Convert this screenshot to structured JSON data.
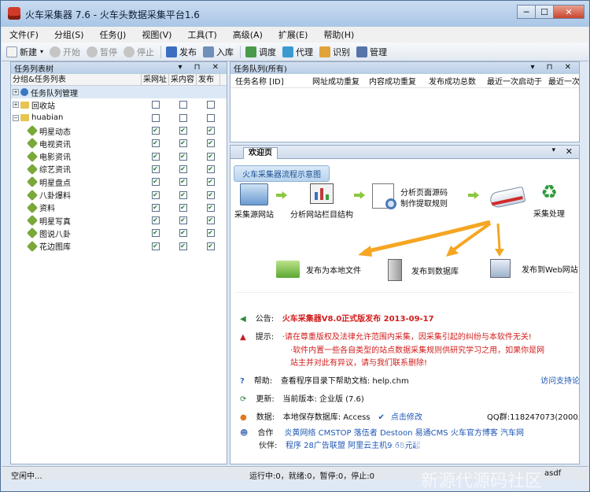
{
  "window": {
    "title": "火车采集器 7.6 - 火车头数据采集平台1.6",
    "min": "─",
    "max": "☐",
    "close": "✕"
  },
  "menu": [
    "文件(F)",
    "分组(S)",
    "任务(J)",
    "视图(V)",
    "工具(T)",
    "高级(A)",
    "扩展(E)",
    "帮助(H)"
  ],
  "toolbar": {
    "new": "新建",
    "start": "开始",
    "pause": "暂停",
    "stop": "停止",
    "publish": "发布",
    "import": "入库",
    "schedule": "调度",
    "proxy": "代理",
    "recognize": "识别",
    "manage": "管理"
  },
  "left": {
    "title": "任务列表树",
    "ctl": "▾ ⊓ ✕",
    "col_group": "分组&任务列表",
    "col_url": "采网址",
    "col_content": "采内容",
    "col_pub": "发布",
    "items": [
      {
        "name": "任务队列管理",
        "type": "queue"
      },
      {
        "name": "回收站",
        "type": "folder"
      },
      {
        "name": "huabian",
        "type": "folder-open"
      },
      {
        "name": "明星动态",
        "type": "task"
      },
      {
        "name": "电视资讯",
        "type": "task"
      },
      {
        "name": "电影资讯",
        "type": "task"
      },
      {
        "name": "综艺资讯",
        "type": "task"
      },
      {
        "name": "明星盘点",
        "type": "task"
      },
      {
        "name": "八卦爆料",
        "type": "task"
      },
      {
        "name": "资料",
        "type": "task"
      },
      {
        "name": "明星写真",
        "type": "task"
      },
      {
        "name": "图说八卦",
        "type": "task"
      },
      {
        "name": "花边图库",
        "type": "task"
      }
    ]
  },
  "queue": {
    "title": "任务队列(所有)",
    "ctl": "▾ ⊓ ✕",
    "cols": [
      "任务名称 [ID]",
      "网址成功重复",
      "内容成功重复",
      "发布成功总数",
      "最近一次启动于",
      "最近一次"
    ]
  },
  "welcome": {
    "tab": "欢迎页",
    "close": "✕",
    "arrow": "▾",
    "flow_title": "火车采集器流程示意图",
    "steps": [
      "采集源网站",
      "分析网站栏目结构",
      "分析页面源码\n制作提取规则",
      "采集处理"
    ],
    "outputs": [
      "发布为本地文件",
      "发布到数据库",
      "发布到Web网站"
    ],
    "rows": [
      {
        "label": "公告:",
        "text": "火车采集器V8.0正式版发布  2013-09-17"
      },
      {
        "label": "提示:",
        "text": "·请在尊重版权及法律允许范围内采集，因采集引起的纠纷与本软件无关!"
      },
      {
        "label": "",
        "text": "·软件内置一些各自类型的站点数据采集规则供研究学习之用，如果你是网"
      },
      {
        "label": "",
        "text": "站主并对此有异议，请与我们联系删除!"
      },
      {
        "label": "帮助:",
        "text": "查看程序目录下帮助文档: help.chm",
        "extra": "访问支持论"
      },
      {
        "label": "更新:",
        "text": "当前版本: 企业版  (7.6)"
      },
      {
        "label": "数据:",
        "text": "本地保存数据库: Access",
        "extra": "点击修改",
        "qq": "QQ群:118247073(2000人"
      },
      {
        "label": "合作",
        "text": "炎黄网络   CMSTOP   落伍者   Destoon   易通CMS   火车官方博客   汽车网"
      },
      {
        "label": "伙伴:",
        "text": "程序   28广告联盟   阿里云主机9.68元起"
      }
    ]
  },
  "status": {
    "left": "空闲中...",
    "mid": "运行中:0，就绪:0，暂停:0，停止:0",
    "right": "asdf"
  },
  "watermark": {
    "big": "XYDai.cn",
    "small": "新源代源码社区"
  },
  "colors": {
    "accent": "#1f57b5",
    "notice": "#d21d1d",
    "arrow": "#f5a623"
  }
}
